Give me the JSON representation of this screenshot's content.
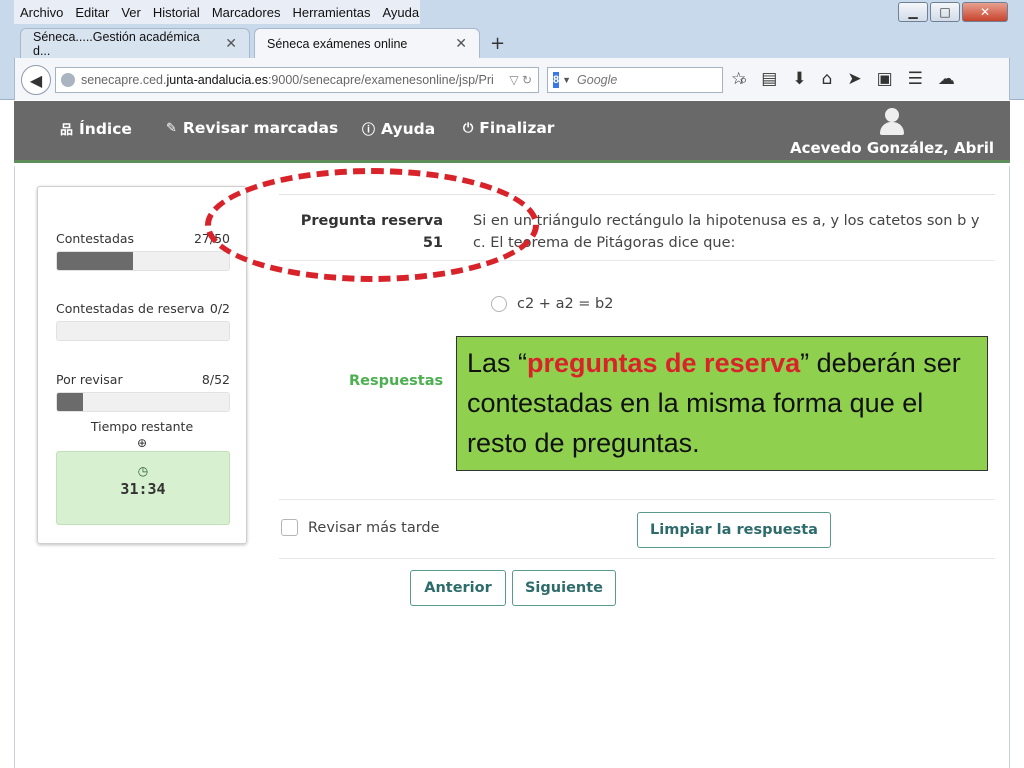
{
  "browser": {
    "menu": [
      "Archivo",
      "Editar",
      "Ver",
      "Historial",
      "Marcadores",
      "Herramientas",
      "Ayuda"
    ],
    "window_controls": [
      "minimize-icon",
      "maximize-icon",
      "close-icon"
    ],
    "tabs": [
      {
        "label": "Séneca.....Gestión académica d...",
        "active": false
      },
      {
        "label": "Séneca exámenes online",
        "active": true
      }
    ],
    "url_prefix": "senecapre.ced.",
    "url_domain": "junta-andalucia.es",
    "url_rest": ":9000/senecapre/examenesonline/jsp/Pri",
    "search_placeholder": "Google",
    "toolbar_icons": [
      "star-icon",
      "reading-list-icon",
      "download-icon",
      "home-icon",
      "send-icon",
      "screenshot-icon",
      "menu-icon",
      "cloud-icon"
    ]
  },
  "app": {
    "nav": [
      {
        "label": "Índice",
        "icon": "sitemap-icon"
      },
      {
        "label": "Revisar marcadas",
        "icon": "pencil-icon"
      },
      {
        "label": "Ayuda",
        "icon": "info-icon"
      },
      {
        "label": "Finalizar",
        "icon": "power-icon"
      }
    ],
    "user_name": "Acevedo González, Abril",
    "header_color": "#696969",
    "accent_color": "#4caf50"
  },
  "sidebar": {
    "answered": {
      "label": "Contestadas",
      "count": "27/50",
      "fraction": 0.44
    },
    "reserve": {
      "label": "Contestadas de reserva",
      "count": "0/2",
      "fraction": 0
    },
    "review": {
      "label": "Por revisar",
      "count": "8/52",
      "fraction": 0.15
    },
    "time_label": "Tiempo restante",
    "time_value": "31:34"
  },
  "question": {
    "label_line1": "Pregunta reserva",
    "number": "51",
    "text": "Si en un triángulo rectángulo la hipotenusa es a, y los catetos son b y c. El teorema de Pitágoras dice que:",
    "options": [
      "c2 + a2 = b2"
    ],
    "answers_label": "Respuestas",
    "review_later": "Revisar más tarde",
    "clear_button": "Limpiar la respuesta",
    "prev_button": "Anterior",
    "next_button": "Siguiente"
  },
  "annotation": {
    "prefix": "Las “",
    "highlight": "preguntas de reserva",
    "suffix": "” deberán ser contestadas en la misma forma que el resto de preguntas.",
    "highlight_color": "#d8232a",
    "box_color": "#8fd14f"
  }
}
